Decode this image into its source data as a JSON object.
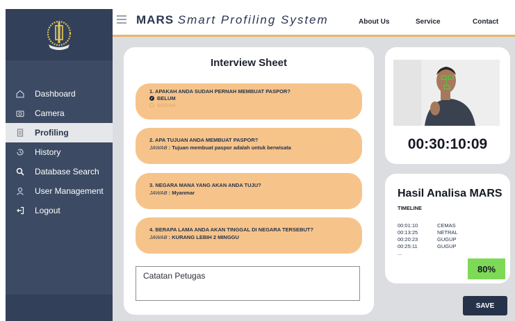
{
  "header": {
    "brand_bold": "MARS",
    "brand_italic": "Smart Profiling System",
    "nav": [
      "About Us",
      "Service",
      "Contact"
    ],
    "accent_color": "#e8b56b"
  },
  "sidebar": {
    "items": [
      {
        "label": "Dashboard",
        "icon": "home-icon"
      },
      {
        "label": "Camera",
        "icon": "camera-icon"
      },
      {
        "label": "Profiling",
        "icon": "document-icon",
        "active": true
      },
      {
        "label": "History",
        "icon": "history-icon"
      },
      {
        "label": "Database Search",
        "icon": "search-icon"
      },
      {
        "label": "User Management",
        "icon": "user-icon"
      },
      {
        "label": "Logout",
        "icon": "logout-icon"
      }
    ],
    "color": "#3c4a63"
  },
  "interview": {
    "title": "Interview Sheet",
    "questions": [
      {
        "question": "1. APAKAH ANDA SUDAH PERNAH MEMBUAT PASPOR?",
        "options": [
          "BELUM",
          "SUDAH"
        ],
        "selected": "BELUM"
      },
      {
        "question": "2. APA TUJUAN ANDA MEMBUAT PASPOR?",
        "answer_label": "JAWAB",
        "answer": ": Tujuan membuat paspor adalah untuk berwisata"
      },
      {
        "question": "3. NEGARA MANA YANG AKAN ANDA TUJU?",
        "answer_label": "JAWAB",
        "answer": ": Myanmar"
      },
      {
        "question": "4. BERAPA LAMA ANDA AKAN TINGGAL DI NEGARA TERSEBUT?",
        "answer_label": "JAWAB",
        "answer": ": KURANG LEBIH 2 MINGGU"
      }
    ],
    "card_color": "#f6c48a",
    "notes_placeholder": "Catatan Petugas"
  },
  "camera": {
    "timer": "00:30:10:09"
  },
  "analysis": {
    "title": "Hasil Analisa MARS",
    "timeline_label": "TIMELINE",
    "timeline": [
      {
        "time": "00:01:10",
        "emotion": "CEMAS"
      },
      {
        "time": "00:13:25",
        "emotion": "NETRAL"
      },
      {
        "time": "00:20:23",
        "emotion": "GUGUP"
      },
      {
        "time": "00:25:11",
        "emotion": "GUGUP"
      }
    ],
    "ellipsis": "...",
    "percent": "80%",
    "percent_color": "#7ed957"
  },
  "actions": {
    "save_label": "SAVE"
  }
}
